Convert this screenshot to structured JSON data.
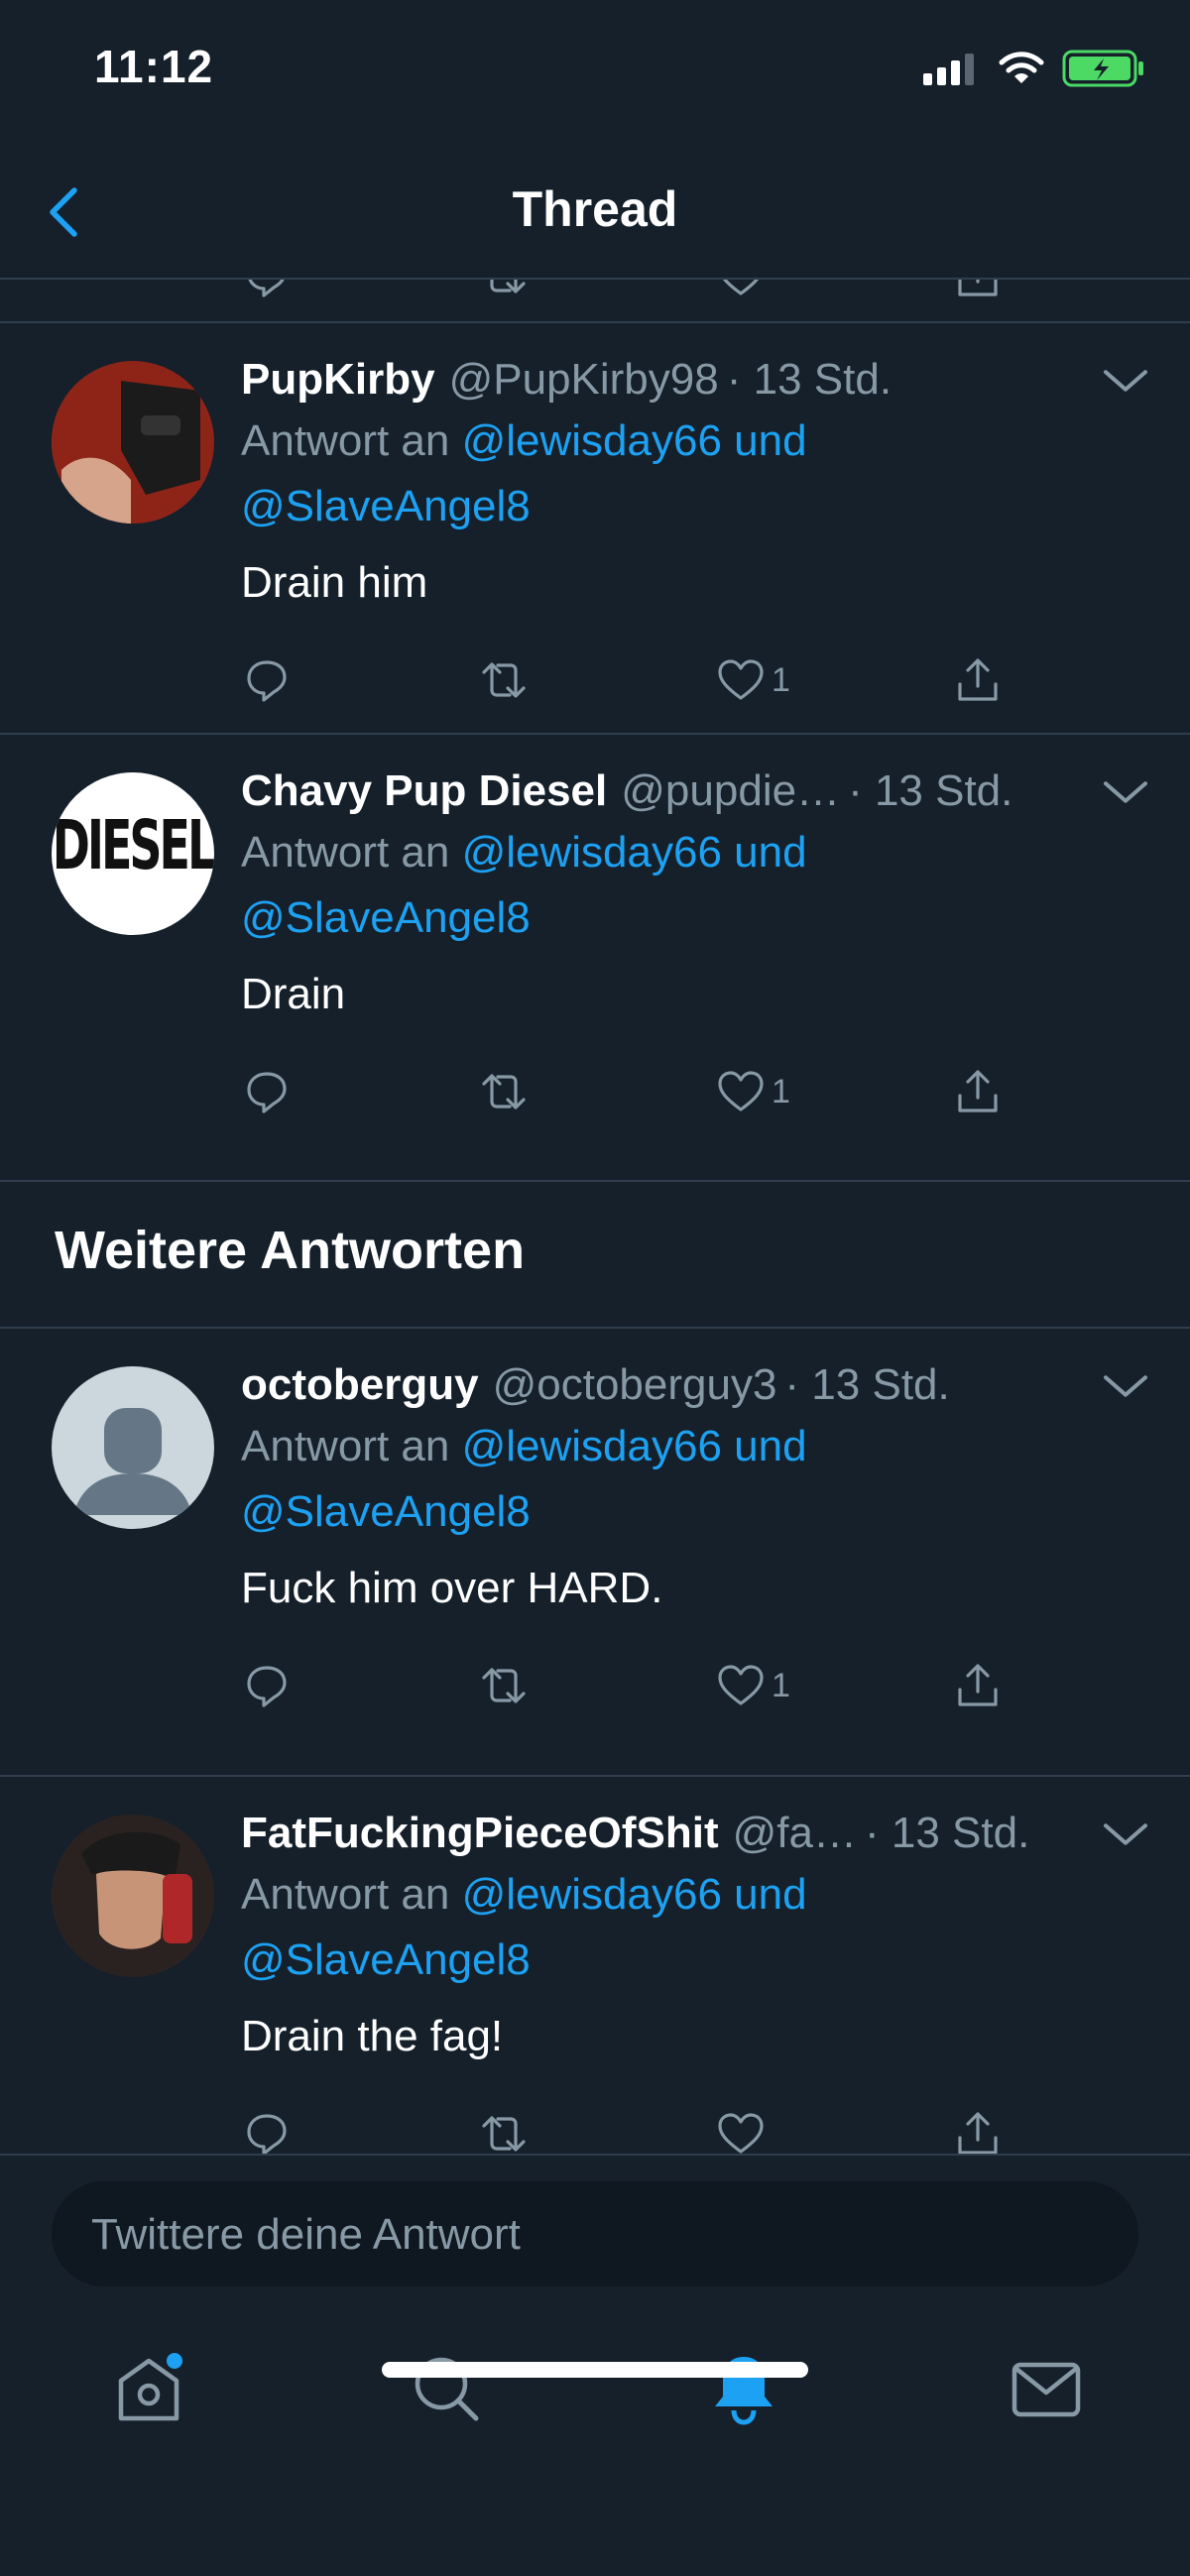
{
  "status_bar": {
    "time": "11:12"
  },
  "header": {
    "title": "Thread"
  },
  "tweets": [
    {
      "display_name": "PupKirby",
      "handle": "@PupKirby98",
      "time": "· 13 Std.",
      "reply_prefix": "Antwort an ",
      "reply_mention_1": "@lewisday66 und",
      "reply_mention_2": "@SlaveAngel8",
      "text": "Drain him",
      "likes": "1"
    },
    {
      "display_name": "Chavy Pup Diesel",
      "handle": "@pupdie…",
      "time": "· 13 Std.",
      "avatar_text": "DIESEL",
      "reply_prefix": "Antwort an ",
      "reply_mention_1": "@lewisday66 und",
      "reply_mention_2": "@SlaveAngel8",
      "text": "Drain",
      "likes": "1"
    },
    {
      "display_name": "octoberguy",
      "handle": "@octoberguy3",
      "time": "· 13 Std.",
      "reply_prefix": "Antwort an ",
      "reply_mention_1": "@lewisday66 und",
      "reply_mention_2": "@SlaveAngel8",
      "text": "Fuck him over HARD.",
      "likes": "1"
    },
    {
      "display_name": "FatFuckingPieceOfShit",
      "handle": "@fa…",
      "time": "· 13 Std.",
      "reply_prefix": "Antwort an ",
      "reply_mention_1": "@lewisday66 und",
      "reply_mention_2": "@SlaveAngel8",
      "text": "Drain the fag!",
      "likes": ""
    }
  ],
  "section": {
    "heading": "Weitere Antworten"
  },
  "composer": {
    "placeholder": "Twittere deine Antwort"
  },
  "tab_bar": {
    "items": [
      {
        "icon": "home-icon",
        "active": false,
        "badge": true
      },
      {
        "icon": "search-icon",
        "active": false
      },
      {
        "icon": "bell-icon",
        "active": true
      },
      {
        "icon": "mail-icon",
        "active": false
      }
    ]
  },
  "colors": {
    "background": "#15202b",
    "accent": "#1da1f2",
    "secondary_text": "#8899a6",
    "battery": "#4cd964"
  }
}
